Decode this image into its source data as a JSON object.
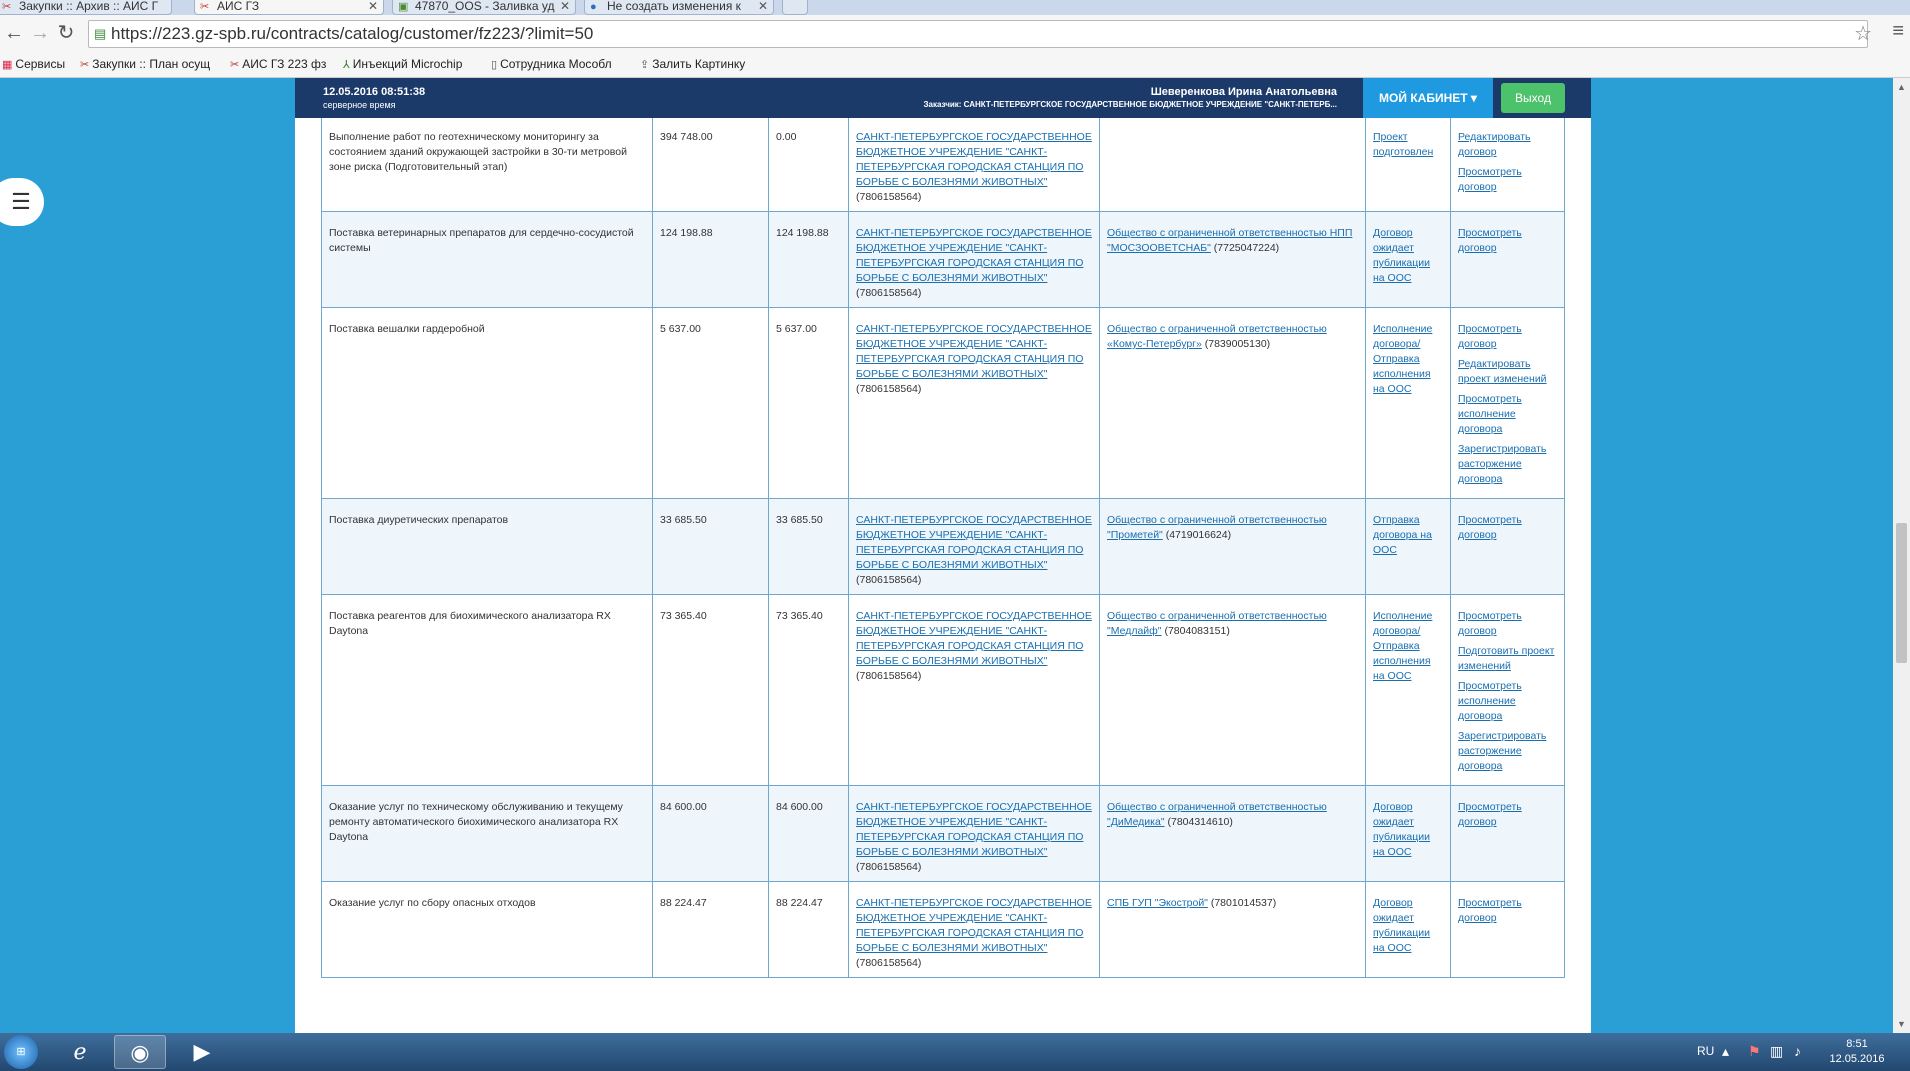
{
  "browser": {
    "tabs": [
      {
        "label": "Закупки :: Архив :: АИС Г"
      },
      {
        "label": "АИС ГЗ"
      },
      {
        "label": "47870_OOS - Заливка уд"
      },
      {
        "label": "Не создать изменения к"
      }
    ],
    "url": "https://223.gz-spb.ru/contracts/catalog/customer/fz223/?limit=50",
    "bookmarks": [
      {
        "label": "Сервисы"
      },
      {
        "label": "Закупки :: План осущ"
      },
      {
        "label": "АИС ГЗ 223 фз"
      },
      {
        "label": "Инъекций Microchip"
      },
      {
        "label": "Сотрудника Мособл"
      },
      {
        "label": "Залить Картинку"
      }
    ]
  },
  "header": {
    "server_time": "12.05.2016 08:51:38",
    "server_time_label": "серверное время",
    "user_name": "Шеверенкова Ирина Анатольевна",
    "customer_line": "Заказчик: САНКТ-ПЕТЕРБУРГСКОЕ ГОСУДАРСТВЕННОЕ БЮДЖЕТНОЕ УЧРЕЖДЕНИЕ \"САНКТ-ПЕТЕРБ...",
    "cabinet_label": "МОЙ КАБИНЕТ ▾",
    "logout_label": "Выход"
  },
  "rows": [
    {
      "subject": "",
      "price": "",
      "paid": "",
      "customer_link": "ГОРОДСКАЯ СТАНЦИЯ ПО БОРЬБЕ С БОЛЕЗНЯМИ ЖИВОТНЫХ\"",
      "customer_inn": " (7806158564)",
      "supplier_link": "",
      "supplier_inn": "",
      "status": "",
      "actions": [
        "договор"
      ]
    },
    {
      "subject": "Выполнение работ по геотехническому мониторингу за состоянием зданий окружающей застройки в 30-ти метровой зоне риска (Подготовительный этап)",
      "price": "394 748.00",
      "paid": "0.00",
      "customer_link": "САНКТ-ПЕТЕРБУРГСКОЕ ГОСУДАРСТВЕННОЕ БЮДЖЕТНОЕ УЧРЕЖДЕНИЕ \"САНКТ-ПЕТЕРБУРГСКАЯ ГОРОДСКАЯ СТАНЦИЯ ПО БОРЬБЕ С БОЛЕЗНЯМИ ЖИВОТНЫХ\"",
      "customer_inn": " (7806158564)",
      "supplier_link": "",
      "supplier_inn": "",
      "status": "Проект подготовлен",
      "actions": [
        "Редактировать договор",
        "Просмотреть договор"
      ]
    },
    {
      "subject": "Поставка ветеринарных препаратов для сердечно-сосудистой системы",
      "price": "124 198.88",
      "paid": "124 198.88",
      "customer_link": "САНКТ-ПЕТЕРБУРГСКОЕ ГОСУДАРСТВЕННОЕ БЮДЖЕТНОЕ УЧРЕЖДЕНИЕ \"САНКТ-ПЕТЕРБУРГСКАЯ ГОРОДСКАЯ СТАНЦИЯ ПО БОРЬБЕ С БОЛЕЗНЯМИ ЖИВОТНЫХ\"",
      "customer_inn": " (7806158564)",
      "supplier_link": "Общество с ограниченной ответственностью НПП \"МОСЗООВЕТСНАБ\"",
      "supplier_inn": " (7725047224)",
      "status": "Договор ожидает публикации на ООС",
      "actions": [
        "Просмотреть договор"
      ]
    },
    {
      "subject": "Поставка вешалки гардеробной",
      "price": "5 637.00",
      "paid": "5 637.00",
      "customer_link": "САНКТ-ПЕТЕРБУРГСКОЕ ГОСУДАРСТВЕННОЕ БЮДЖЕТНОЕ УЧРЕЖДЕНИЕ \"САНКТ-ПЕТЕРБУРГСКАЯ ГОРОДСКАЯ СТАНЦИЯ ПО БОРЬБЕ С БОЛЕЗНЯМИ ЖИВОТНЫХ\"",
      "customer_inn": " (7806158564)",
      "supplier_link": "Общество с ограниченной ответственностью «Комус-Петербург»",
      "supplier_inn": " (7839005130)",
      "status": "Исполнение договора/ Отправка исполнения на ООС",
      "actions": [
        "Просмотреть договор",
        "Редактировать проект изменений",
        "Просмотреть исполнение договора",
        "Зарегистрировать расторжение договора"
      ]
    },
    {
      "subject": "Поставка диуретических препаратов",
      "price": "33 685.50",
      "paid": "33 685.50",
      "customer_link": "САНКТ-ПЕТЕРБУРГСКОЕ ГОСУДАРСТВЕННОЕ БЮДЖЕТНОЕ УЧРЕЖДЕНИЕ \"САНКТ-ПЕТЕРБУРГСКАЯ ГОРОДСКАЯ СТАНЦИЯ ПО БОРЬБЕ С БОЛЕЗНЯМИ ЖИВОТНЫХ\"",
      "customer_inn": " (7806158564)",
      "supplier_link": "Общество с ограниченной ответственностью \"Прометей\"",
      "supplier_inn": " (4719016624)",
      "status": "Отправка договора на ООС",
      "actions": [
        "Просмотреть договор"
      ]
    },
    {
      "subject": "Поставка реагентов для биохимического анализатора RX Daytona",
      "price": "73 365.40",
      "paid": "73 365.40",
      "customer_link": "САНКТ-ПЕТЕРБУРГСКОЕ ГОСУДАРСТВЕННОЕ БЮДЖЕТНОЕ УЧРЕЖДЕНИЕ \"САНКТ-ПЕТЕРБУРГСКАЯ ГОРОДСКАЯ СТАНЦИЯ ПО БОРЬБЕ С БОЛЕЗНЯМИ ЖИВОТНЫХ\"",
      "customer_inn": " (7806158564)",
      "supplier_link": "Общество с ограниченной ответственностью \"Медлайф\"",
      "supplier_inn": " (7804083151)",
      "status": "Исполнение договора/ Отправка исполнения на ООС",
      "actions": [
        "Просмотреть договор",
        "Подготовить проект изменений",
        "Просмотреть исполнение договора",
        "Зарегистрировать расторжение договора"
      ]
    },
    {
      "subject": "Оказание услуг по техническому обслуживанию и текущему ремонту автоматического биохимического анализатора RX Daytona",
      "price": "84 600.00",
      "paid": "84 600.00",
      "customer_link": "САНКТ-ПЕТЕРБУРГСКОЕ ГОСУДАРСТВЕННОЕ БЮДЖЕТНОЕ УЧРЕЖДЕНИЕ \"САНКТ-ПЕТЕРБУРГСКАЯ ГОРОДСКАЯ СТАНЦИЯ ПО БОРЬБЕ С БОЛЕЗНЯМИ ЖИВОТНЫХ\"",
      "customer_inn": " (7806158564)",
      "supplier_link": "Общество с ограниченной ответственностью \"ДиМедика\"",
      "supplier_inn": " (7804314610)",
      "status": "Договор ожидает публикации на ООС",
      "actions": [
        "Просмотреть договор"
      ]
    },
    {
      "subject": "Оказание услуг по сбору опасных отходов",
      "price": "88 224.47",
      "paid": "88 224.47",
      "customer_link": "САНКТ-ПЕТЕРБУРГСКОЕ ГОСУДАРСТВЕННОЕ БЮДЖЕТНОЕ УЧРЕЖДЕНИЕ \"САНКТ-ПЕТЕРБУРГСКАЯ ГОРОДСКАЯ СТАНЦИЯ ПО БОРЬБЕ С БОЛЕЗНЯМИ ЖИВОТНЫХ\"",
      "customer_inn": " (7806158564)",
      "supplier_link": "СПБ ГУП \"Экострой\"",
      "supplier_inn": " (7801014537)",
      "status": "Договор ожидает публикации на ООС",
      "actions": [
        "Просмотреть договор"
      ]
    }
  ],
  "taskbar": {
    "language": "RU",
    "clock_time": "8:51",
    "clock_date": "12.05.2016"
  },
  "icons": {
    "start": "windows-start-icon",
    "ie": "internet-explorer-icon",
    "chrome": "chrome-icon",
    "media": "media-player-icon"
  }
}
